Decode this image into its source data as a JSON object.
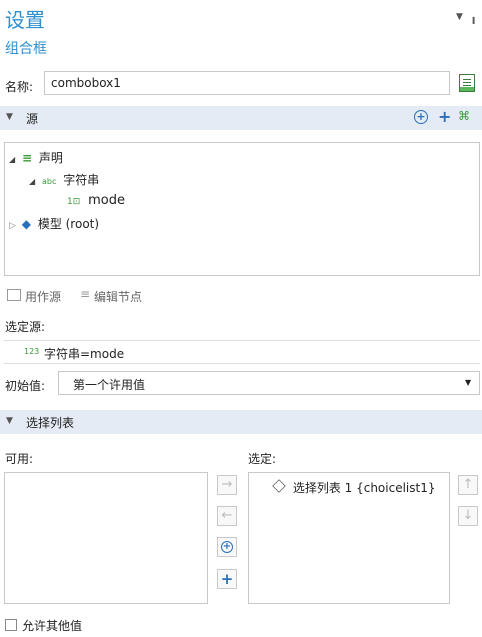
{
  "header": {
    "title": "设置",
    "subtitle": "组合框"
  },
  "name_row": {
    "label": "名称:",
    "value": "combobox1"
  },
  "source_section": {
    "label": "源"
  },
  "tree": {
    "node_declaration": "声明",
    "node_string": "字符串",
    "node_string_tag": "abc",
    "node_mode": "mode",
    "node_model": "模型 (root)"
  },
  "tree_toolbar": {
    "use_as_source": "用作源",
    "edit_node": "编辑节点"
  },
  "selected_source": {
    "label": "选定源:",
    "tag": "123",
    "value": "字符串=mode"
  },
  "initial_value": {
    "label": "初始值:",
    "value": "第一个许用值"
  },
  "choice_section": {
    "label": "选择列表"
  },
  "available": {
    "label": "可用:"
  },
  "selected": {
    "label": "选定:",
    "items": [
      "选择列表 1 {choicelist1}"
    ]
  },
  "allow_other": {
    "label": "允许其他值"
  },
  "colors": {
    "accent": "#2f8fcf",
    "section_bg": "#e4ebf4",
    "green_icon": "#3a9a3a",
    "blue_icon": "#2a6fb8"
  }
}
